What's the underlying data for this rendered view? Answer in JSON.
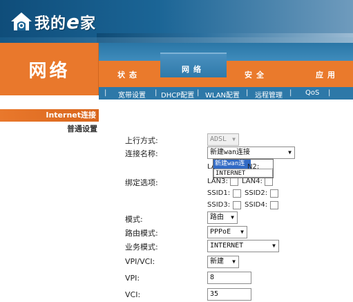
{
  "logo": {
    "text_main": "我的",
    "text_e": "e",
    "text_end": "家"
  },
  "section": {
    "title": "网络"
  },
  "main_nav": {
    "tabs": [
      {
        "label": "状态",
        "selected": false
      },
      {
        "label": "网络",
        "selected": true
      },
      {
        "label": "安全",
        "selected": false
      },
      {
        "label": "应用",
        "selected": false
      }
    ]
  },
  "sub_nav": {
    "separator": "|",
    "items": [
      "宽带设置",
      "DHCP配置",
      "WLAN配置",
      "远程管理",
      "QoS"
    ]
  },
  "sidebar": {
    "items": [
      {
        "label": "Internet连接",
        "selected": true
      },
      {
        "label": "普通设置",
        "selected": false
      }
    ]
  },
  "form": {
    "upstream_label": "上行方式:",
    "upstream_value": "ADSL",
    "connection_label": "连接名称:",
    "connection_value": "新建wan连接",
    "dropdown_options": [
      "新建wan连接",
      "INTERNET"
    ],
    "binding_label": "绑定选项:",
    "lan_partial_left": "LA",
    "lan_partial_right": "N2:",
    "lan3_label": "LAN3:",
    "lan4_label": "LAN4:",
    "ssid1_label": "SSID1:",
    "ssid2_label": "SSID2:",
    "ssid3_label": "SSID3:",
    "ssid4_label": "SSID4:",
    "mode_label": "模式:",
    "mode_value": "路由",
    "route_mode_label": "路由模式:",
    "route_mode_value": "PPPoE",
    "service_mode_label": "业务模式:",
    "service_mode_value": "INTERNET",
    "vpivci_label": "VPI/VCI:",
    "vpivci_value": "新建",
    "vpi_label": "VPI:",
    "vpi_value": "8",
    "vci_label": "VCI:",
    "vci_value": "35"
  },
  "colors": {
    "orange": "#e9782c",
    "blue": "#2d78a8",
    "header_blue": "#0f4d7a",
    "selection": "#316ac5"
  }
}
